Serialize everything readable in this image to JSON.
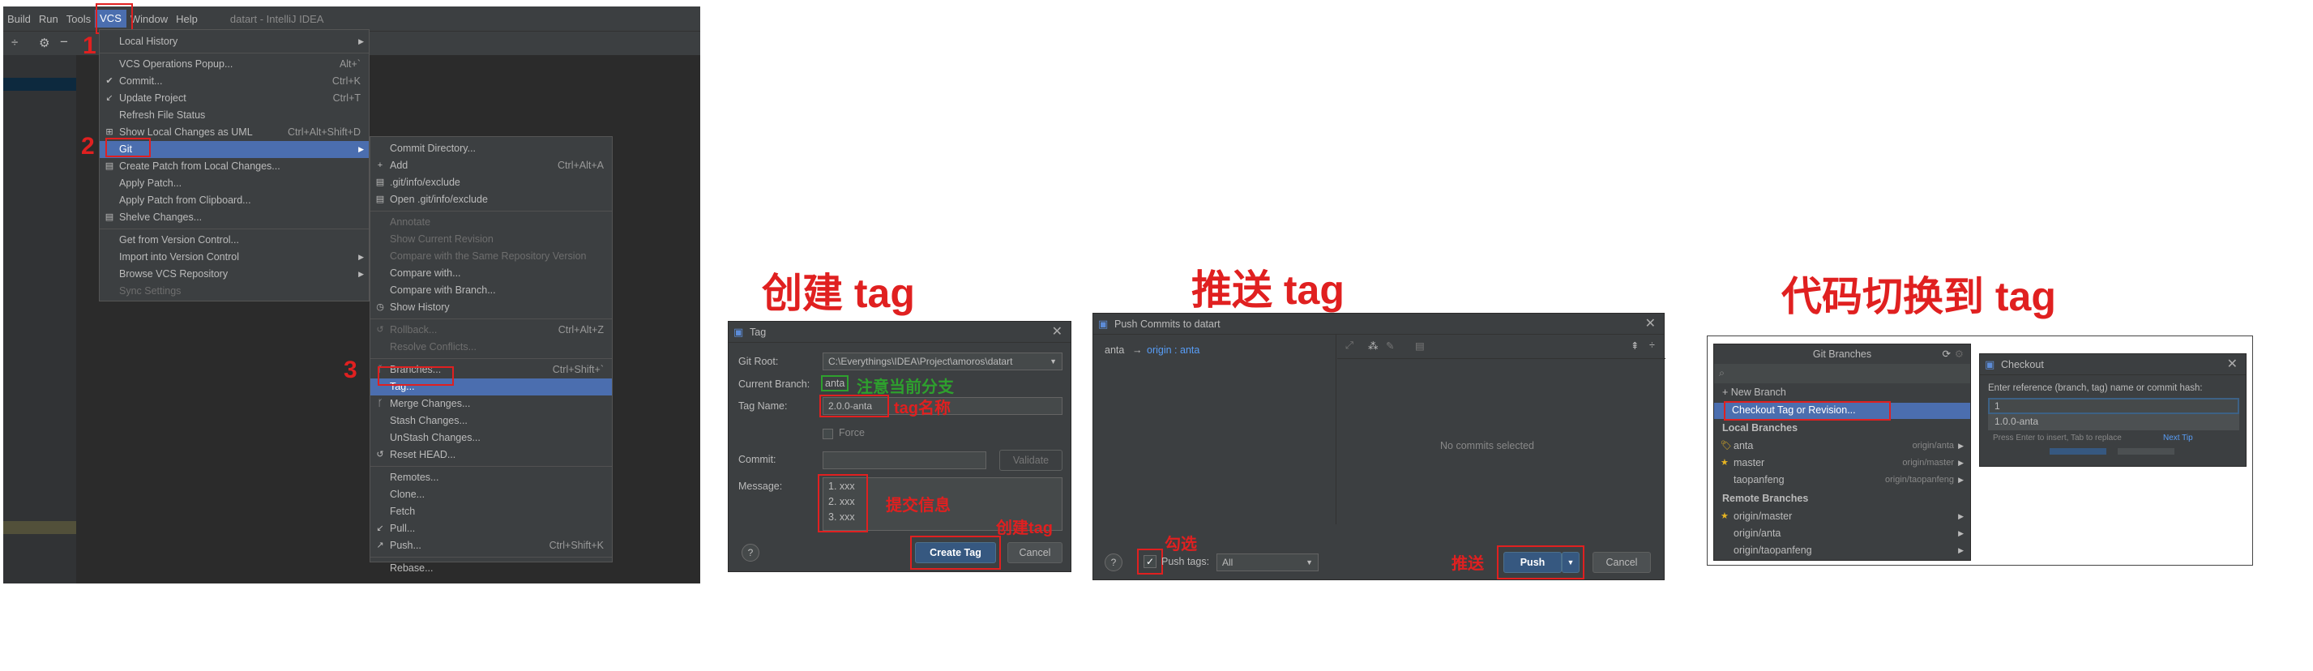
{
  "ide": {
    "menubar": [
      "Build",
      "Run",
      "Tools",
      "VCS",
      "Window",
      "Help"
    ],
    "title": "datart - IntelliJ IDEA"
  },
  "vcs_menu": [
    {
      "label": "Local History",
      "arrow": true
    },
    {
      "sep": true
    },
    {
      "label": "VCS Operations Popup...",
      "shortcut": "Alt+`"
    },
    {
      "label": "Commit...",
      "shortcut": "Ctrl+K",
      "icon": "✔"
    },
    {
      "label": "Update Project",
      "shortcut": "Ctrl+T",
      "icon": "↙"
    },
    {
      "label": "Refresh File Status"
    },
    {
      "label": "Show Local Changes as UML",
      "shortcut": "Ctrl+Alt+Shift+D",
      "icon": "⊞"
    },
    {
      "label": "Git",
      "arrow": true,
      "selected": true
    },
    {
      "label": "Create Patch from Local Changes...",
      "icon": "▤"
    },
    {
      "label": "Apply Patch..."
    },
    {
      "label": "Apply Patch from Clipboard..."
    },
    {
      "label": "Shelve Changes...",
      "icon": "▤"
    },
    {
      "sep": true
    },
    {
      "label": "Get from Version Control..."
    },
    {
      "label": "Import into Version Control",
      "arrow": true
    },
    {
      "label": "Browse VCS Repository",
      "arrow": true
    },
    {
      "label": "Sync Settings",
      "disabled": true
    }
  ],
  "git_menu": [
    {
      "label": "Commit Directory..."
    },
    {
      "label": "Add",
      "shortcut": "Ctrl+Alt+A",
      "icon": "+"
    },
    {
      "label": ".git/info/exclude",
      "icon": "▤"
    },
    {
      "label": "Open .git/info/exclude",
      "icon": "▤"
    },
    {
      "sep": true
    },
    {
      "label": "Annotate",
      "disabled": true
    },
    {
      "label": "Show Current Revision",
      "disabled": true
    },
    {
      "label": "Compare with the Same Repository Version",
      "disabled": true
    },
    {
      "label": "Compare with..."
    },
    {
      "label": "Compare with Branch..."
    },
    {
      "label": "Show History",
      "icon": "◷"
    },
    {
      "sep": true
    },
    {
      "label": "Rollback...",
      "shortcut": "Ctrl+Alt+Z",
      "disabled": true,
      "icon": "↺"
    },
    {
      "label": "Resolve Conflicts...",
      "disabled": true
    },
    {
      "sep": true
    },
    {
      "label": "Branches...",
      "shortcut": "Ctrl+Shift+`",
      "icon": "ᚴ"
    },
    {
      "label": "Tag...",
      "selected": true
    },
    {
      "label": "Merge Changes...",
      "icon": "ᚴ"
    },
    {
      "label": "Stash Changes..."
    },
    {
      "label": "UnStash Changes..."
    },
    {
      "label": "Reset HEAD...",
      "icon": "↺"
    },
    {
      "sep": true
    },
    {
      "label": "Remotes..."
    },
    {
      "label": "Clone..."
    },
    {
      "label": "Fetch"
    },
    {
      "label": "Pull...",
      "icon": "↙"
    },
    {
      "label": "Push...",
      "shortcut": "Ctrl+Shift+K",
      "icon": "↗"
    },
    {
      "sep": true
    },
    {
      "label": "Rebase..."
    }
  ],
  "step_numbers": [
    "1",
    "2",
    "3"
  ],
  "headings": {
    "create_tag": "创建 tag",
    "push_tag": "推送 tag",
    "checkout_tag": "代码切换到 tag"
  },
  "tag_dialog": {
    "title": "Tag",
    "git_root_label": "Git Root:",
    "git_root_value": "C:\\Everythings\\IDEA\\Project\\amoros\\datart",
    "current_branch_label": "Current Branch:",
    "current_branch_value": "anta",
    "tag_name_label": "Tag Name:",
    "tag_name_value": "2.0.0-anta",
    "force_label": "Force",
    "commit_label": "Commit:",
    "validate_label": "Validate",
    "message_label": "Message:",
    "message_lines": [
      "1. xxx",
      "2. xxx",
      "3. xxx"
    ],
    "create_label": "Create Tag",
    "cancel_label": "Cancel",
    "help": "?",
    "ann_branch": "注意当前分支",
    "ann_tagname": "tag名称",
    "ann_message": "提交信息",
    "ann_create": "创建tag"
  },
  "push_dialog": {
    "title": "Push Commits to datart",
    "branch_from": "anta",
    "arrow": "→",
    "branch_to": "origin : anta",
    "no_commits": "No commits selected",
    "push_tags_label": "Push tags:",
    "push_tags_value": "All",
    "push_label": "Push",
    "cancel_label": "Cancel",
    "help": "?",
    "ann_check": "勾选",
    "ann_push": "推送"
  },
  "branches_popup": {
    "title": "Git Branches",
    "new_branch": "+ New Branch",
    "checkout": "Checkout Tag or Revision...",
    "local_header": "Local Branches",
    "local": [
      {
        "name": "anta",
        "remote": "origin/anta",
        "icon": "tag"
      },
      {
        "name": "master",
        "remote": "origin/master",
        "icon": "star"
      },
      {
        "name": "taopanfeng",
        "remote": "origin/taopanfeng",
        "icon": ""
      }
    ],
    "remote_header": "Remote Branches",
    "remote": [
      {
        "name": "origin/master",
        "icon": "star"
      },
      {
        "name": "origin/anta",
        "icon": ""
      },
      {
        "name": "origin/taopanfeng",
        "icon": ""
      }
    ]
  },
  "checkout_dialog": {
    "title": "Checkout",
    "prompt": "Enter reference (branch, tag) name or commit hash:",
    "input_value": "1",
    "suggestion": "1.0.0-anta",
    "hint": "Press Enter to insert, Tab to replace",
    "next_tip": "Next Tip"
  },
  "colors": {
    "accent_red": "#e02020",
    "annotation_green": "#2ea02e",
    "selection": "#4b6eaf"
  }
}
